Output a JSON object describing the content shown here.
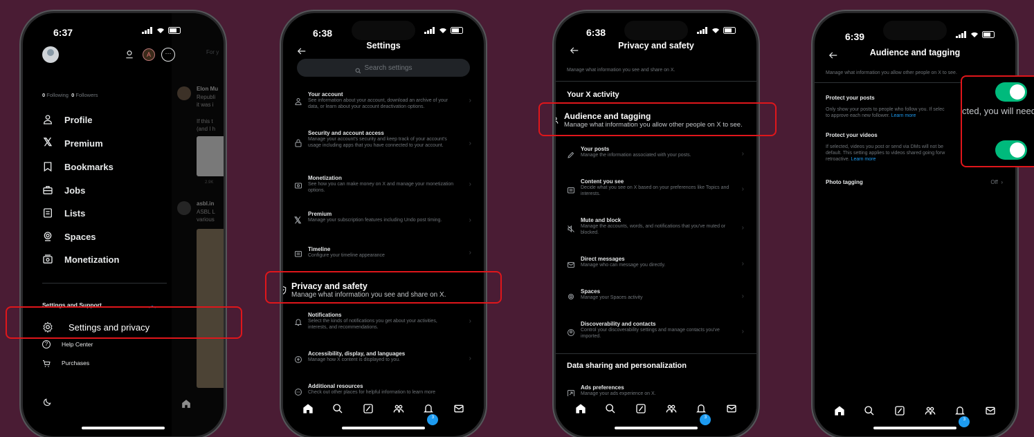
{
  "p1": {
    "time": "6:37",
    "following_count": "0",
    "following_label": "Following",
    "followers_count": "0",
    "followers_label": "Followers",
    "menu": [
      "Profile",
      "Premium",
      "Bookmarks",
      "Jobs",
      "Lists",
      "Spaces",
      "Monetization"
    ],
    "section": "Settings and Support",
    "settings_privacy": "Settings and privacy",
    "help": "Help Center",
    "purchases": "Purchases",
    "bg_tab": "For y",
    "bg_name1": "Elon Mu",
    "bg_line1": "Republi",
    "bg_line2": "it was i",
    "bg_line3": "If this t",
    "bg_line4": "(and I h",
    "bg_count": "2.9K",
    "bg_name2": "asbl.in",
    "bg_line5": "ASBL L",
    "bg_line6": "various"
  },
  "p2": {
    "time": "6:38",
    "title": "Settings",
    "search_placeholder": "Search settings",
    "items": [
      {
        "title": "Your account",
        "desc": "See information about your account, download an archive of your data, or learn about your account deactivation options."
      },
      {
        "title": "Security and account access",
        "desc": "Manage your account's security and keep track of your account's usage including apps that you have connected to your account."
      },
      {
        "title": "Monetization",
        "desc": "See how you can make money on X and manage your monetization options."
      },
      {
        "title": "Premium",
        "desc": "Manage your subscription features including Undo post timing."
      },
      {
        "title": "Timeline",
        "desc": "Configure your timeline appearance"
      },
      {
        "title": "Privacy and safety",
        "desc": "Manage what information you see and share on X."
      },
      {
        "title": "Notifications",
        "desc": "Select the kinds of notifications you get about your activities, interests, and recommendations."
      },
      {
        "title": "Accessibility, display, and languages",
        "desc": "Manage how X content is displayed to you."
      },
      {
        "title": "Additional resources",
        "desc": "Check out other places for helpful information to learn more"
      }
    ],
    "badge": "3"
  },
  "p3": {
    "time": "6:38",
    "title": "Privacy and safety",
    "intro": "Manage what information you see and share on X.",
    "section1": "Your X activity",
    "items": [
      {
        "title": "Audience and tagging",
        "desc": "Manage what information you allow other people on X to see."
      },
      {
        "title": "Your posts",
        "desc": "Manage the information associated with your posts."
      },
      {
        "title": "Content you see",
        "desc": "Decide what you see on X based on your preferences like Topics and interests."
      },
      {
        "title": "Mute and block",
        "desc": "Manage the accounts, words, and notifications that you've muted or blocked."
      },
      {
        "title": "Direct messages",
        "desc": "Manage who can message you directly."
      },
      {
        "title": "Spaces",
        "desc": "Manage your Spaces activity"
      },
      {
        "title": "Discoverability and contacts",
        "desc": "Control your discoverability settings and manage contacts you've imported."
      }
    ],
    "section2": "Data sharing and personalization",
    "ads_title": "Ads preferences",
    "ads_desc": "Manage your ads experience on X.",
    "badge": "3"
  },
  "p4": {
    "time": "6:39",
    "title": "Audience and tagging",
    "intro": "Manage what information you allow other people on X to see.",
    "protect_posts": "Protect your posts",
    "protect_posts_desc": "Only show your posts to people who follow you. If selec",
    "protect_posts_desc2": "to approve each new follower.",
    "learn_more": "Learn more",
    "protect_videos": "Protect your videos",
    "protect_videos_desc": "If selected, videos you post or send via DMs will not be",
    "protect_videos_desc2": "default. This setting applies to videos shared going forw",
    "protect_videos_desc3": "retroactive.",
    "photo_tagging": "Photo tagging",
    "photo_tagging_value": "Off",
    "zoom_text": "cted, you will need",
    "badge": "3"
  },
  "colors": {
    "background": "#4a1c34",
    "highlight": "#e0161b",
    "toggle": "#00ba7c",
    "badge": "#1d9bf0"
  }
}
